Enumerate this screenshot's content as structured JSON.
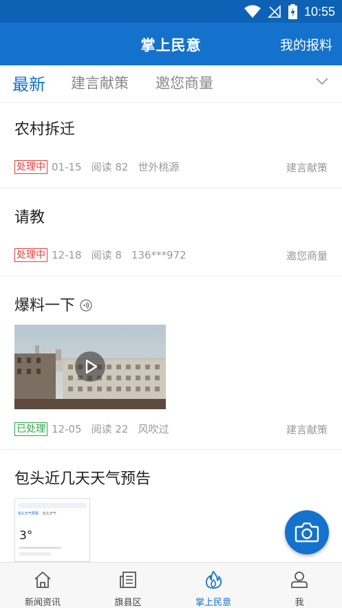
{
  "status_bar": {
    "time": "10:55",
    "icons": [
      "wifi-icon",
      "no-signal-icon",
      "battery-charging-icon"
    ]
  },
  "app_bar": {
    "title": "掌上民意",
    "action_label": "我的报料"
  },
  "tabs": [
    {
      "label": "最新",
      "active": true
    },
    {
      "label": "建言献策",
      "active": false
    },
    {
      "label": "邀您商量",
      "active": false
    }
  ],
  "posts": [
    {
      "title": "农村拆迁",
      "status": "处理中",
      "date": "01-15",
      "reads": "阅读 82",
      "author": "世外桃源",
      "category": "建言献策"
    },
    {
      "title": "请教",
      "status": "处理中",
      "date": "12-18",
      "reads": "阅读 8",
      "author": "136***972",
      "category": "邀您商量"
    },
    {
      "title": "爆料一下",
      "status": "已处理",
      "date": "12-05",
      "reads": "阅读 22",
      "author": "风吹过",
      "category": "建言献策",
      "has_audio": true,
      "has_video": true
    },
    {
      "title": "包头近几天天气预告"
    }
  ],
  "weather_thumb": {
    "temp": "3°",
    "tab1": "包头天气预报",
    "tab2": "包头天气"
  },
  "bottom_nav": [
    {
      "label": "新闻资讯",
      "icon": "home-icon",
      "active": false
    },
    {
      "label": "旗县区",
      "icon": "news-icon",
      "active": false
    },
    {
      "label": "掌上民意",
      "icon": "flame-icon",
      "active": true
    },
    {
      "label": "我",
      "icon": "person-icon",
      "active": false
    }
  ],
  "colors": {
    "primary": "#1472cc",
    "status_bar": "#0d62b5",
    "pending": "#e23d3d",
    "done": "#28a745"
  }
}
